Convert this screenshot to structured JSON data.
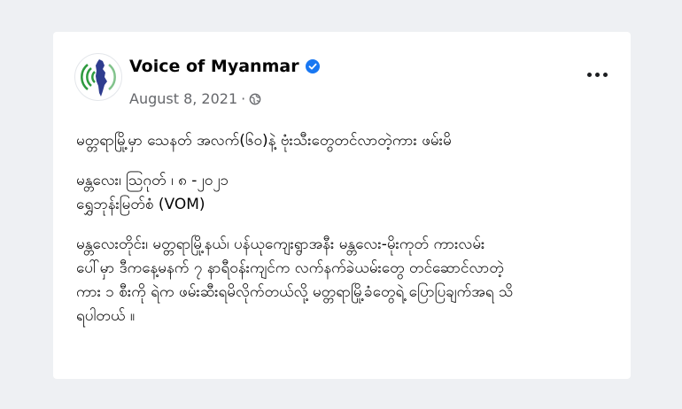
{
  "post": {
    "page_name": "Voice of Myanmar",
    "verified_icon": "verified-badge-icon",
    "date": "August 8, 2021",
    "separator": "·",
    "audience_icon": "globe-icon",
    "more_icon": "more-horizontal-icon",
    "headline": "မတ္တရာမြို့မှာ သေနတ် အလက်(၆၀)နဲ့ ဗုံးသီးတွေတင်လာတဲ့ကား ဖမ်းမိ",
    "dateline_1": "မန္တလေး၊ ဩဂုတ် ၊ ၈ -၂၀၂၁",
    "dateline_2": "ရွှေဘုန်းမြတ်စံ (VOM)",
    "paragraph_lines": [
      "မန္တလေးတိုင်း၊ မတ္တရာမြို့နယ်၊ ပန်ယုကျေးရွာအနီး မန္တလေး-မိုးကုတ် ကားလမ်း",
      "ပေါ်မှာ ဒီကနေ့မနက် ၇ နာရီ၀န်းကျင်က လက်နက်ခဲယမ်းတွေ တင်ဆောင်လာတဲ့",
      "ကား ၁ စီးကို ရဲက ဖမ်းဆီးရမိလိုက်တယ်လို့ မတ္တရာမြို့ခံတွေရဲ့ ပြောပြချက်အရ သိ",
      "ရပါတယ် ။"
    ]
  },
  "colors": {
    "page_background": "#eef0f3",
    "card_background": "#ffffff",
    "verified_blue": "#1877f2",
    "secondary_text": "#65676b",
    "logo_green": "#2e9b3f",
    "logo_map_blue": "#2f3d8f"
  }
}
